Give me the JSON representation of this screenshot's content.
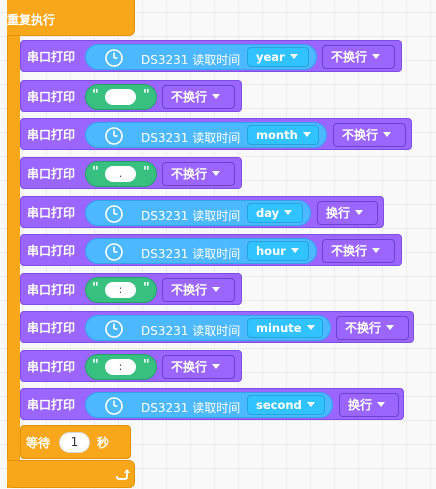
{
  "loop": {
    "title": "重复执行"
  },
  "serial_label": "串口打印",
  "ds_label": "DS3231 读取时间",
  "blocks": [
    {
      "kind": "time",
      "field": "year",
      "mode": "不换行"
    },
    {
      "kind": "text",
      "text": " ",
      "mode": "不换行"
    },
    {
      "kind": "time",
      "field": "month",
      "mode": "不换行"
    },
    {
      "kind": "text",
      "text": ".",
      "mode": "不换行"
    },
    {
      "kind": "time",
      "field": "day",
      "mode": "换行"
    },
    {
      "kind": "time",
      "field": "hour",
      "mode": "不换行"
    },
    {
      "kind": "text",
      "text": ":",
      "mode": "不换行"
    },
    {
      "kind": "time",
      "field": "minute",
      "mode": "不换行"
    },
    {
      "kind": "text",
      "text": ":",
      "mode": "不换行"
    },
    {
      "kind": "time",
      "field": "second",
      "mode": "换行"
    }
  ],
  "wait": {
    "label": "等待",
    "value": "1",
    "unit": "秒"
  },
  "colors": {
    "control": "#f7a719",
    "serial_block": "#9a66ff",
    "time_reporter": "#4cb8ff",
    "text_reporter": "#38c081",
    "dropdown": "#31c3ff"
  },
  "icons": {
    "clock": "clock-icon",
    "loop_arrow": "loop-arrow-icon",
    "dropdown": "chevron-down-icon"
  }
}
